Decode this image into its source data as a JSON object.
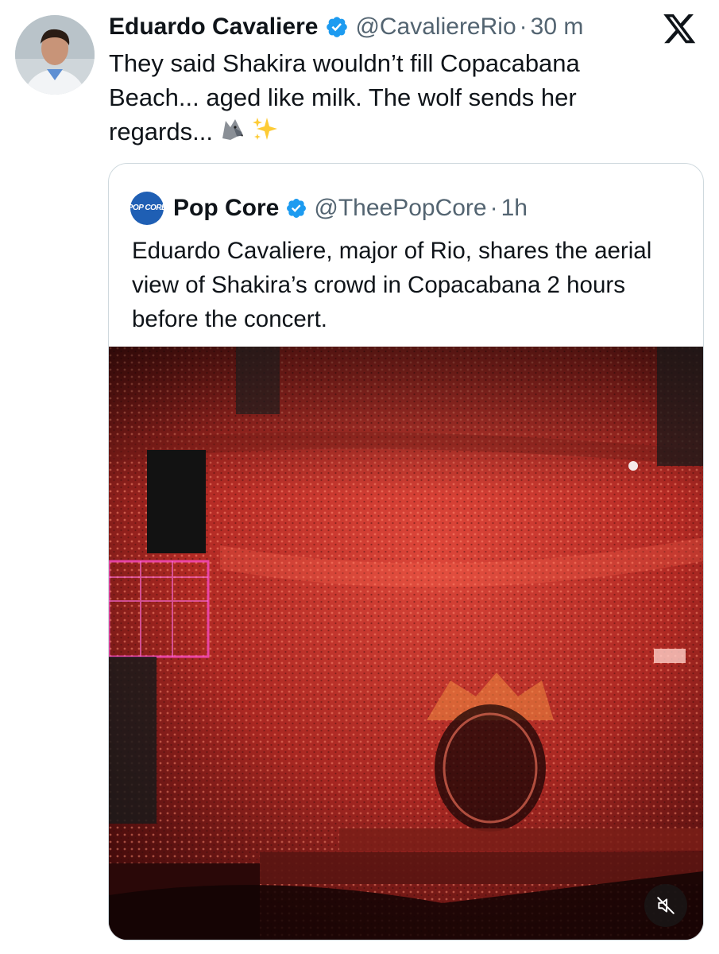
{
  "tweet": {
    "author_name": "Eduardo Cavaliere",
    "handle": "@CavaliereRio",
    "separator": "·",
    "time": "30 m",
    "text": "They said Shakira wouldn’t fill Copacabana Beach... aged like milk. The wolf sends her regards...",
    "emojis": [
      "wolf-emoji",
      "sparkles-emoji"
    ]
  },
  "quoted": {
    "avatar_text": "POP CORE",
    "author_name": "Pop Core",
    "handle": "@TheePopCore",
    "separator": "·",
    "time": "1h",
    "text": "Eduardo Cavaliere, major of Rio, shares the aerial view of Shakira’s crowd in Copacabana 2 hours before the concert.",
    "media": {
      "kind": "video",
      "muted": true
    }
  },
  "icons": {
    "verified": "verified-badge-icon",
    "brand": "x-logo-icon",
    "mute": "speaker-muted-icon"
  },
  "colors": {
    "verified_blue": "#1d9bf0",
    "secondary_text": "#536471",
    "border": "#cfd9de",
    "crowd_red": "#d8372c"
  }
}
